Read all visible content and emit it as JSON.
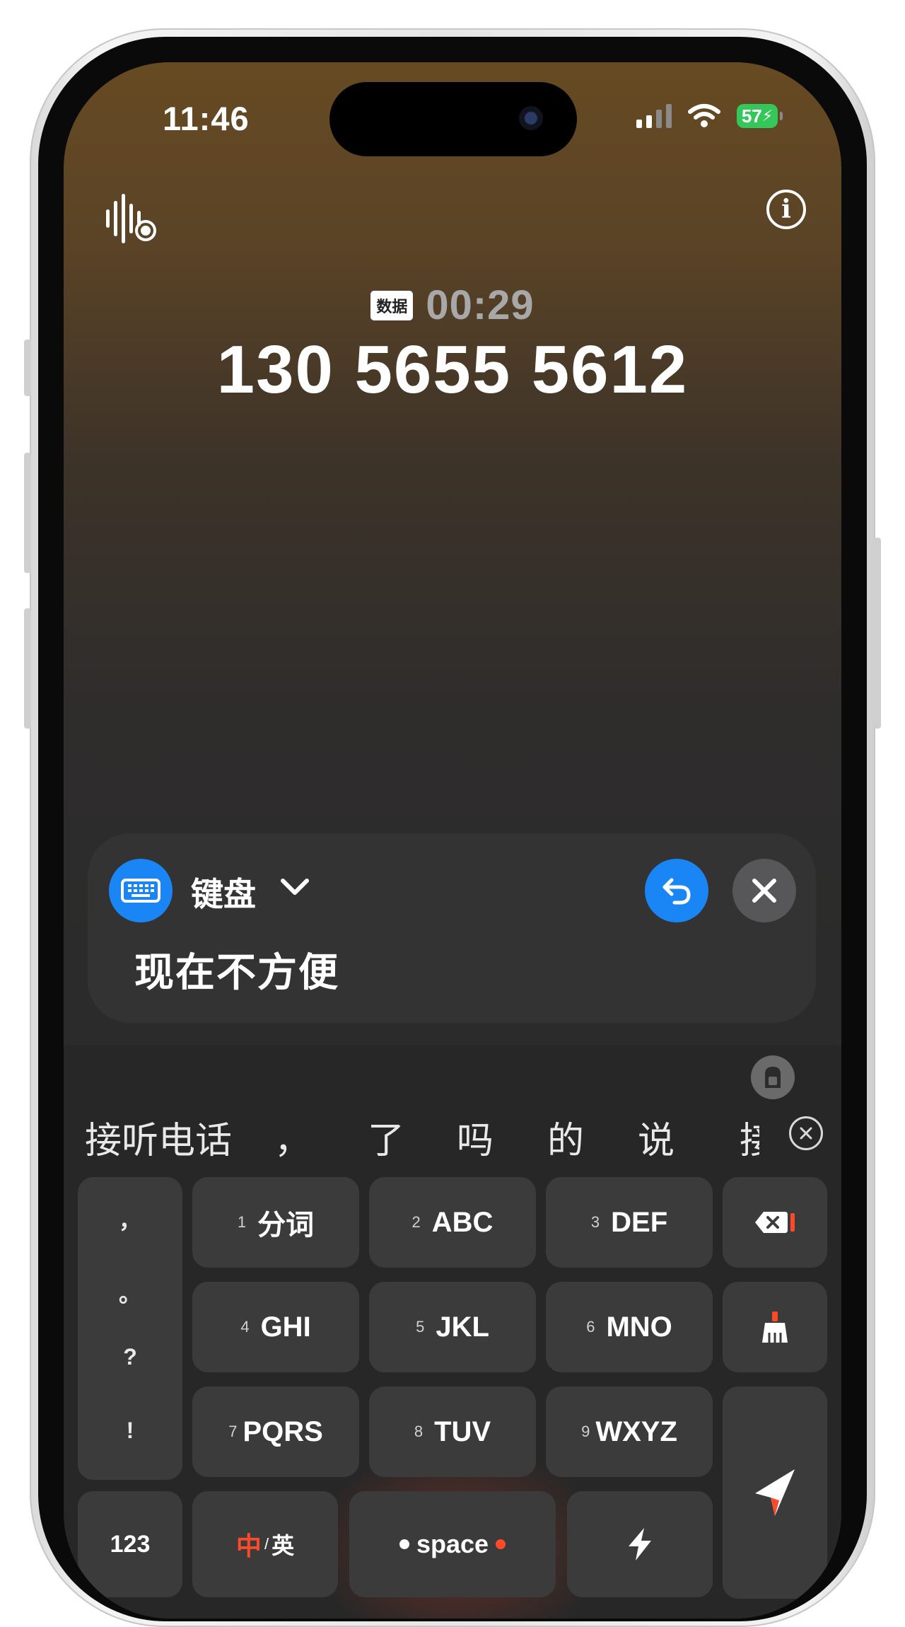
{
  "status_bar": {
    "time": "11:46",
    "battery": "57"
  },
  "call": {
    "network_badge": "数据",
    "timer": "00:29",
    "number": "130 5655 5612"
  },
  "reply_panel": {
    "mode_label": "键盘",
    "text": "现在不方便"
  },
  "keyboard": {
    "candidates": [
      "接听电话",
      "，",
      "了",
      "吗",
      "的",
      "说",
      "接"
    ],
    "punctuation": [
      "，",
      "。",
      "?",
      "!"
    ],
    "keys": [
      {
        "num": "1",
        "label": "分词"
      },
      {
        "num": "2",
        "label": "ABC"
      },
      {
        "num": "3",
        "label": "DEF"
      },
      {
        "num": "4",
        "label": "GHI"
      },
      {
        "num": "5",
        "label": "JKL"
      },
      {
        "num": "6",
        "label": "MNO"
      },
      {
        "num": "7",
        "label": "PQRS"
      },
      {
        "num": "8",
        "label": "TUV"
      },
      {
        "num": "9",
        "label": "WXYZ"
      }
    ],
    "numeric_key": "123",
    "lang_cn": "中",
    "lang_sep": "/",
    "lang_en": "英",
    "space_label": "space"
  },
  "colors": {
    "accent_blue": "#1a86f5",
    "battery_green": "#34c759",
    "accent_red": "#ff4a2a"
  }
}
